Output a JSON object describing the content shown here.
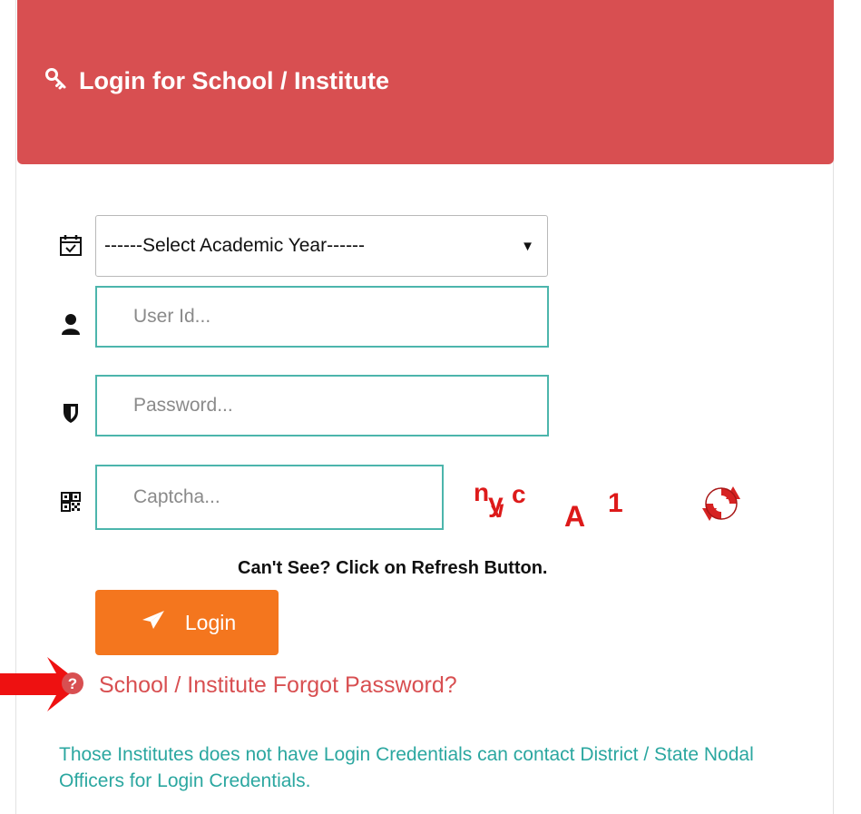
{
  "header": {
    "title": "Login for School / Institute",
    "icon": "key-icon",
    "background_color": "#d84f51"
  },
  "form": {
    "academic_year": {
      "selected": "------Select Academic Year------",
      "icon": "calendar-check-icon"
    },
    "user_id": {
      "value": "",
      "placeholder": "User Id...",
      "icon": "user-icon"
    },
    "password": {
      "value": "",
      "placeholder": "Password...",
      "icon": "shield-icon"
    },
    "captcha": {
      "value": "",
      "placeholder": "Captcha...",
      "icon": "qrcode-icon",
      "image_text": "nyvc A 1"
    },
    "refresh_icon": "refresh-icon",
    "hint": "Can't See? Click on Refresh Button.",
    "login_label": "Login",
    "login_icon": "paper-plane-icon",
    "login_color": "#f4761e"
  },
  "forgot": {
    "icon": "question-circle-icon",
    "label": "School / Institute Forgot Password?",
    "color": "#d84f51"
  },
  "annotation": {
    "icon": "red-arrow-icon",
    "color": "#ee1111"
  },
  "info": {
    "text": "Those Institutes does not have Login Credentials can contact District / State Nodal Officers for Login Credentials.",
    "color": "#2ba7a0"
  }
}
